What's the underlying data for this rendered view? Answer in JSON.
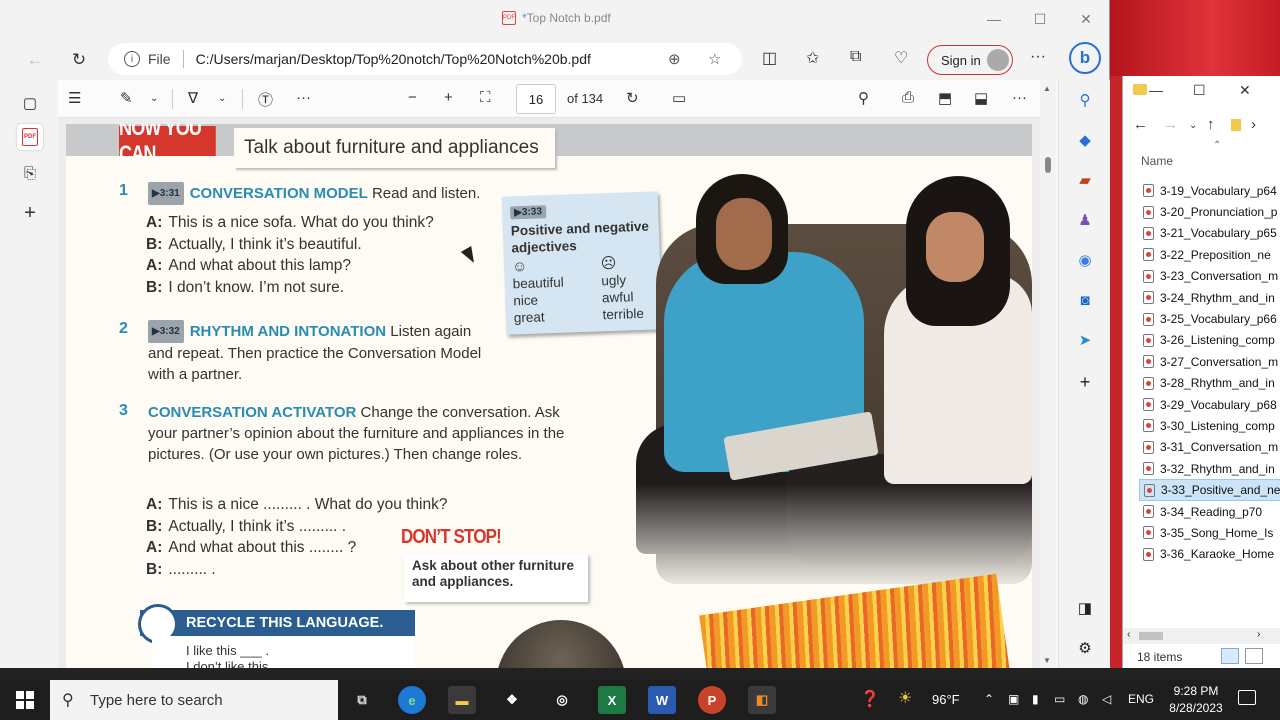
{
  "browser": {
    "tab_title": "*Top Notch b.pdf",
    "url_scheme": "File",
    "url": "C:/Users/marjan/Desktop/Top%20notch/Top%20Notch%20b.pdf",
    "sign_in_label": "Sign in"
  },
  "pdf_toolbar": {
    "page_number": "16",
    "page_of": "of 134"
  },
  "page": {
    "banner_label": "NOW YOU CAN",
    "banner_title": "Talk about furniture and appliances",
    "sec1": {
      "num": "1",
      "track": "3:31",
      "heading": "CONVERSATION MODEL",
      "instruction": "Read and listen.",
      "lines": [
        {
          "speaker": "A:",
          "text": "This is a nice sofa. What do you think?"
        },
        {
          "speaker": "B:",
          "text": "Actually, I think it’s beautiful."
        },
        {
          "speaker": "A:",
          "text": "And what about this lamp?"
        },
        {
          "speaker": "B:",
          "text": "I don’t know. I’m not sure."
        }
      ]
    },
    "sec2": {
      "num": "2",
      "track": "3:32",
      "heading": "RHYTHM AND INTONATION",
      "instruction": "Listen again and repeat. Then practice the Conversation Model with a partner."
    },
    "sec3": {
      "num": "3",
      "heading": "CONVERSATION ACTIVATOR",
      "instruction": "Change the conversation. Ask your partner’s opinion about the furniture and appliances in the pictures. (Or use your own pictures.) Then change roles.",
      "lines": [
        {
          "speaker": "A:",
          "text": "This is a nice ......... . What do you think?"
        },
        {
          "speaker": "B:",
          "text": "Actually, I think it’s ......... ."
        },
        {
          "speaker": "A:",
          "text": "And what about this ........ ?"
        },
        {
          "speaker": "B:",
          "text": "......... ."
        }
      ]
    },
    "adjectives": {
      "track": "3:33",
      "title": "Positive and negative adjectives",
      "positive": [
        "beautiful",
        "nice",
        "great"
      ],
      "negative": [
        "ugly",
        "awful",
        "terrible"
      ]
    },
    "dont_stop": {
      "title": "DON’T STOP!",
      "text": "Ask about other furniture and appliances."
    },
    "recycle": {
      "title": "RECYCLE THIS LANGUAGE.",
      "lines": [
        "I like this ___ .",
        "I don’t like this"
      ]
    }
  },
  "explorer": {
    "column_header": "Name",
    "files": [
      "3-19_Vocabulary_p64",
      "3-20_Pronunciation_p",
      "3-21_Vocabulary_p65",
      "3-22_Preposition_ne",
      "3-23_Conversation_m",
      "3-24_Rhythm_and_in",
      "3-25_Vocabulary_p66",
      "3-26_Listening_comp",
      "3-27_Conversation_m",
      "3-28_Rhythm_and_in",
      "3-29_Vocabulary_p68",
      "3-30_Listening_comp",
      "3-31_Conversation_m",
      "3-32_Rhythm_and_in",
      "3-33_Positive_and_ne",
      "3-34_Reading_p70",
      "3-35_Song_Home_Is",
      "3-36_Karaoke_Home"
    ],
    "selected_index": 14,
    "status": "18 items"
  },
  "taskbar": {
    "search_placeholder": "Type here to search",
    "weather": "96°F",
    "lang": "ENG",
    "time": "9:28 PM",
    "date": "8/28/2023"
  }
}
